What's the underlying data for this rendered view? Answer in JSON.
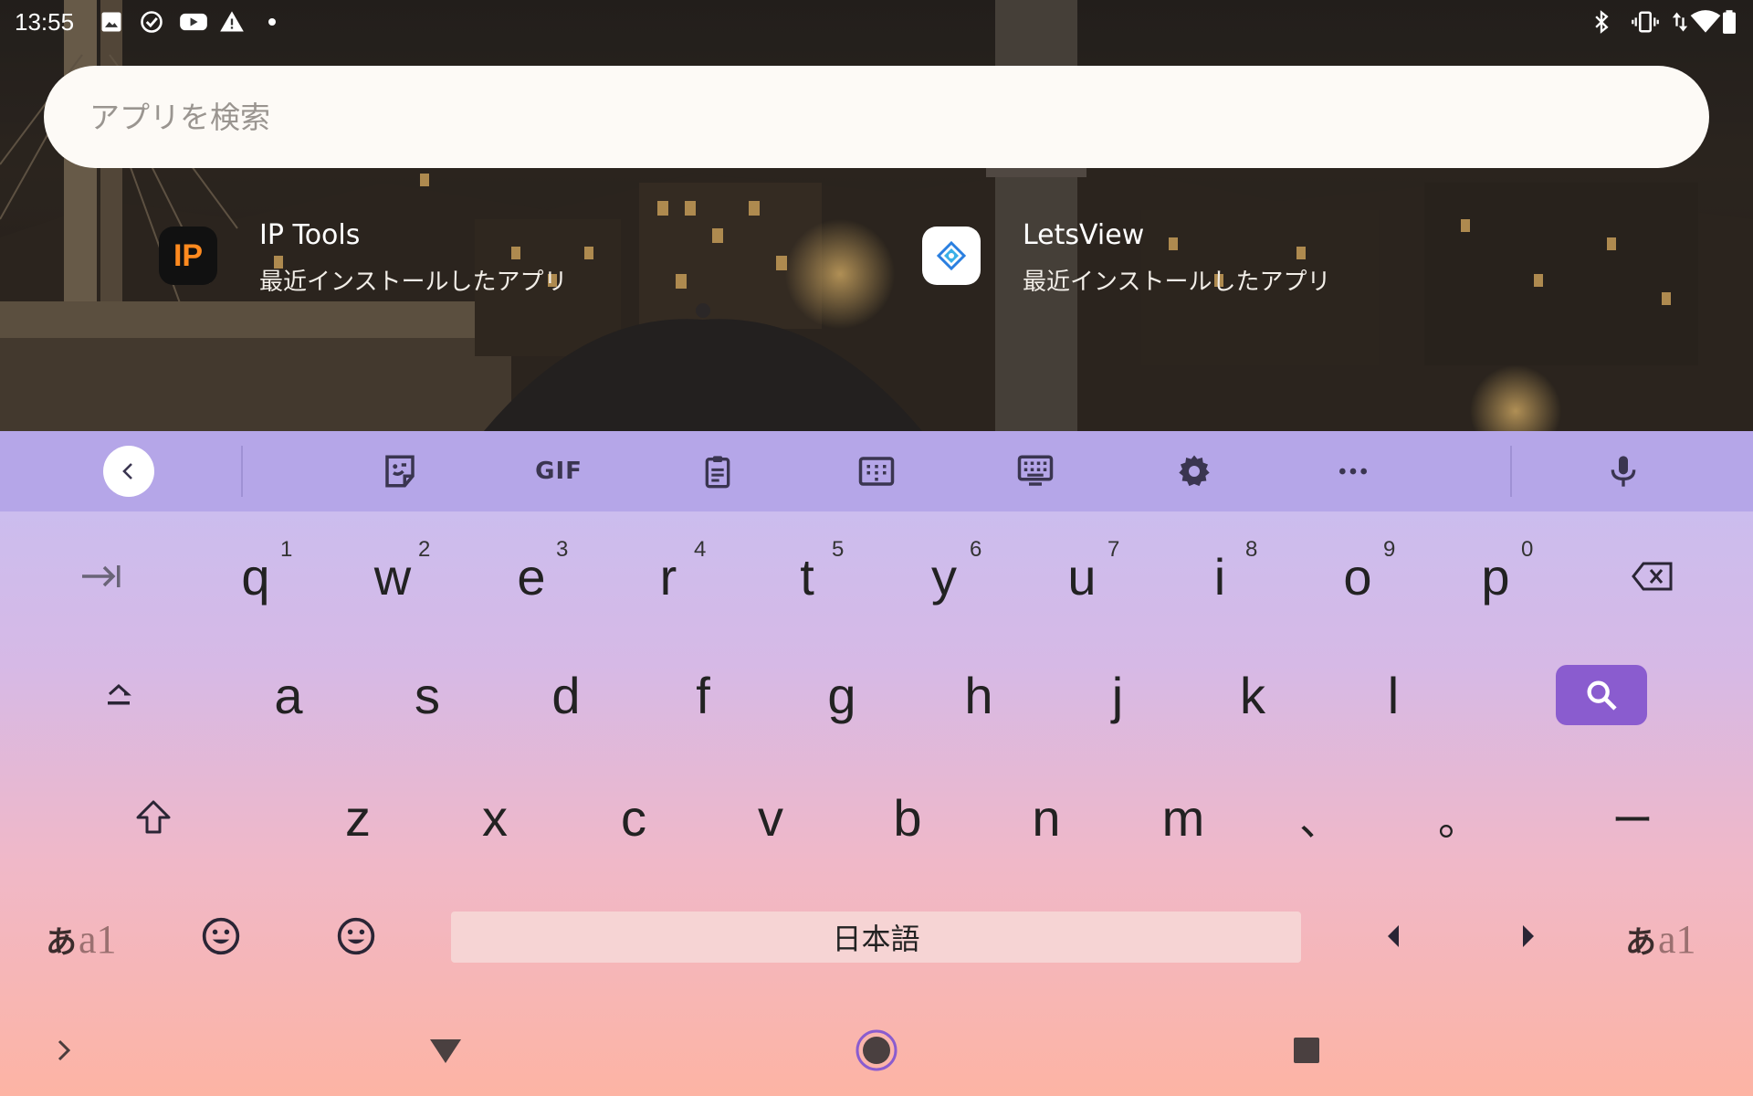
{
  "status_bar": {
    "time": "13:55",
    "left_icons": [
      "image-icon",
      "check-circle-icon",
      "youtube-icon",
      "warning-icon",
      "dot-icon"
    ],
    "right_icons": [
      "bluetooth-icon",
      "vibrate-icon",
      "data-arrows-icon",
      "wifi-icon",
      "battery-icon"
    ]
  },
  "search": {
    "placeholder": "アプリを検索",
    "value": ""
  },
  "recent_apps": [
    {
      "name": "IP Tools",
      "subtitle": "最近インストールしたアプリ",
      "icon_text": "IP",
      "icon_bg": "#111111",
      "icon_fg": "#ff8a1f"
    },
    {
      "name": "LetsView",
      "subtitle": "最近インストールしたアプリ",
      "icon_bg": "#ffffff",
      "icon_fg": "#2a7fe0"
    }
  ],
  "keyboard": {
    "toolbar": {
      "items": [
        "collapse-icon",
        "sticker-icon",
        "gif",
        "clipboard-icon",
        "numpad-icon",
        "keyboard-icon",
        "settings-icon",
        "more-icon",
        "mic-icon"
      ],
      "gif_label": "GIF"
    },
    "row1": [
      {
        "label": "q",
        "hint": "1"
      },
      {
        "label": "w",
        "hint": "2"
      },
      {
        "label": "e",
        "hint": "3"
      },
      {
        "label": "r",
        "hint": "4"
      },
      {
        "label": "t",
        "hint": "5"
      },
      {
        "label": "y",
        "hint": "6"
      },
      {
        "label": "u",
        "hint": "7"
      },
      {
        "label": "i",
        "hint": "8"
      },
      {
        "label": "o",
        "hint": "9"
      },
      {
        "label": "p",
        "hint": "0"
      }
    ],
    "row2": [
      "a",
      "s",
      "d",
      "f",
      "g",
      "h",
      "j",
      "k",
      "l"
    ],
    "row3": [
      "z",
      "x",
      "c",
      "v",
      "b",
      "n",
      "m",
      "、",
      "。",
      "ー"
    ],
    "space_label": "日本語",
    "mode_key": {
      "a": "あ",
      "b": "a1"
    },
    "accent_color": "#8a5ccf"
  },
  "nav_bar": {
    "items": [
      "chevron-right-icon",
      "back-triangle-icon",
      "home-circle-icon",
      "recents-square-icon"
    ]
  }
}
